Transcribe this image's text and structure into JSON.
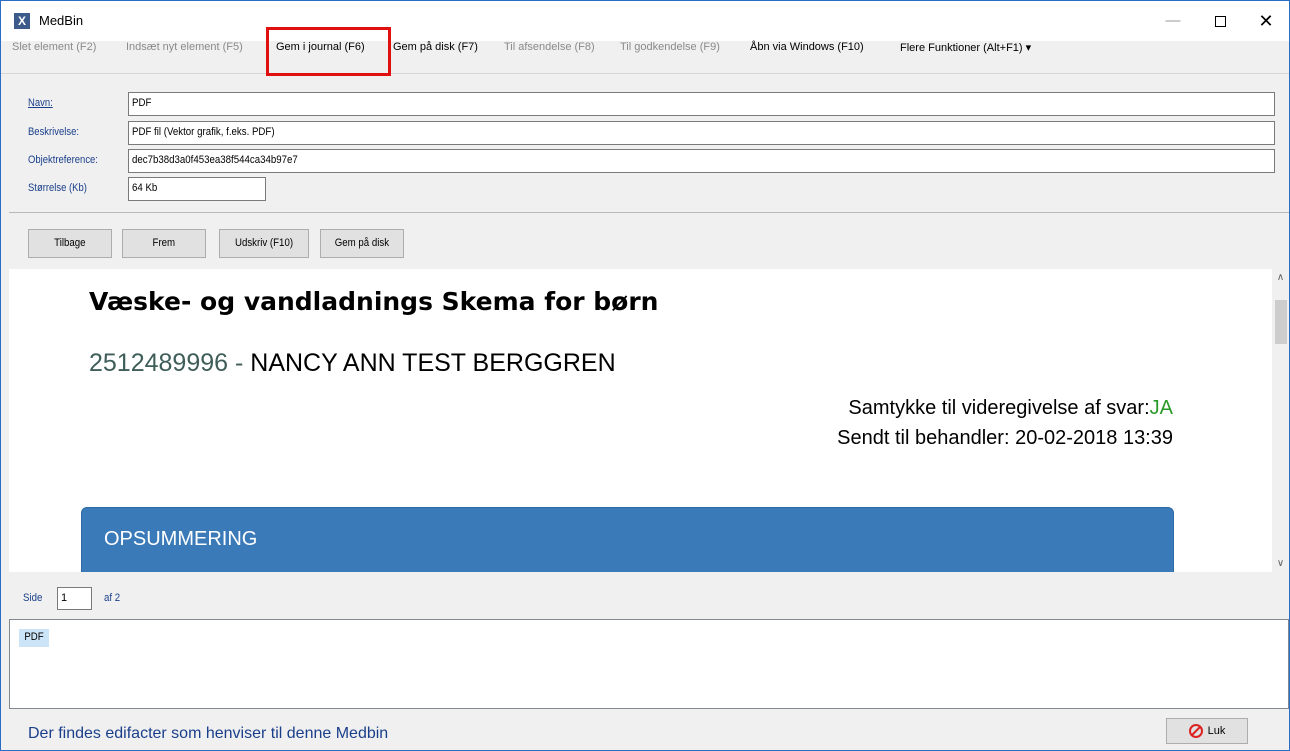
{
  "window": {
    "title": "MedBin",
    "app_icon_glyph": "X",
    "min_glyph": "—",
    "close_glyph": "✕"
  },
  "menu": {
    "items": [
      {
        "label": "Slet element (F2)",
        "state": "disabled"
      },
      {
        "label": "Indsæt nyt element (F5)",
        "state": "disabled"
      },
      {
        "label": "Gem i journal (F6)",
        "state": "enabled"
      },
      {
        "label": "Gem på disk (F7)",
        "state": "enabled"
      },
      {
        "label": "Til afsendelse (F8)",
        "state": "disabled"
      },
      {
        "label": "Til godkendelse (F9)",
        "state": "disabled"
      },
      {
        "label": "Åbn via Windows (F10)",
        "state": "enabled"
      },
      {
        "label": "Flere Funktioner (Alt+F1) ▾",
        "state": "enabled"
      }
    ],
    "highlight_color": "#e01010"
  },
  "form": {
    "name_label": "Navn:",
    "name_value": "PDF",
    "description_label": "Beskrivelse:",
    "description_value": "PDF fil (Vektor grafik, f.eks. PDF)",
    "object_ref_label": "Objektreference:",
    "object_ref_value": "dec7b38d3a0f453ea38f544ca34b97e7",
    "size_label": "Størrelse (Kb)",
    "size_value": "64 Kb"
  },
  "nav_buttons": {
    "back": "Tilbage",
    "forward": "Frem",
    "print": "Udskriv (F10)",
    "save_disk": "Gem på disk"
  },
  "document": {
    "title": "Væske- og vandladnings Skema for børn",
    "patient_cpr": "2512489996",
    "patient_separator": " - ",
    "patient_name": "NANCY ANN TEST BERGGREN",
    "consent_label": "Samtykke til videregivelse af svar:",
    "consent_value": "JA",
    "sent_label": "Sendt til behandler: ",
    "sent_value": "20-02-2018 13:39",
    "summary_title": "OPSUMMERING",
    "summary_color": "#3b7ab8"
  },
  "pager": {
    "side_label": "Side",
    "page_value": "1",
    "of_label": "af 2"
  },
  "list": {
    "items": [
      "PDF"
    ]
  },
  "status": {
    "message": "Der findes edifacter som henviser til denne Medbin",
    "close_button": "Luk"
  }
}
